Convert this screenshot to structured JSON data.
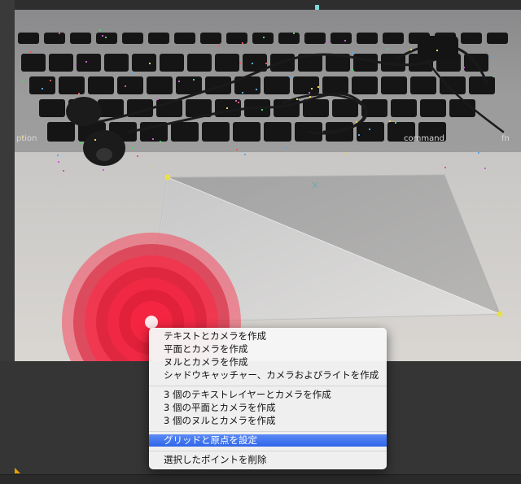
{
  "context_menu": {
    "items": [
      {
        "label": "テキストとカメラを作成",
        "selected": false
      },
      {
        "label": "平面とカメラを作成",
        "selected": false
      },
      {
        "label": "ヌルとカメラを作成",
        "selected": false
      },
      {
        "label": "シャドウキャッチャー、カメラおよびライトを作成",
        "selected": false
      },
      {
        "label": "3 個のテキストレイヤーとカメラを作成",
        "selected": false
      },
      {
        "label": "3 個の平面とカメラを作成",
        "selected": false
      },
      {
        "label": "3 個のヌルとカメラを作成",
        "selected": false
      },
      {
        "label": "グリッドと原点を設定",
        "selected": true
      },
      {
        "label": "選択したポイントを削除",
        "selected": false
      }
    ]
  },
  "keyboard_labels": {
    "command": "command",
    "option": "ption",
    "fn": "fn"
  },
  "colors": {
    "target": "#ff2a45",
    "track_point_yellow": "#e8e04a",
    "menu_highlight": "#3a6fee"
  }
}
